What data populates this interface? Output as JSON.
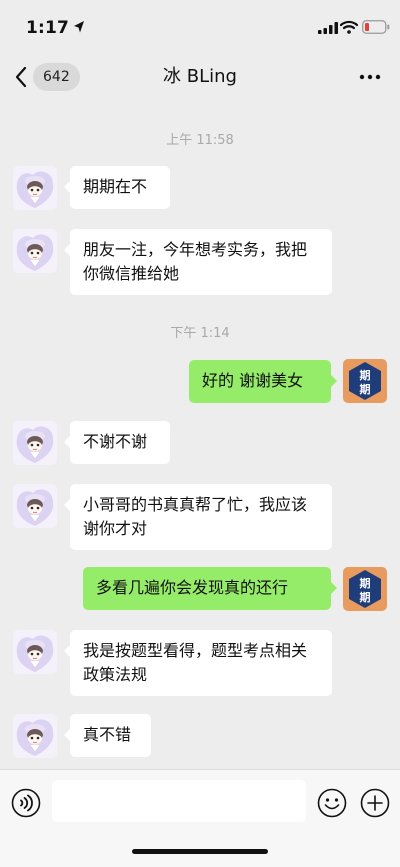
{
  "status_bar": {
    "time": "1:17",
    "icons": [
      "location-arrow-icon",
      "signal-icon",
      "wifi-icon",
      "battery-low-icon"
    ]
  },
  "nav": {
    "unread_count": "642",
    "title": "冰 BLing",
    "icons": [
      "back-icon",
      "more-icon"
    ]
  },
  "messages": {
    "t1": "上午 11:58",
    "m1": "期期在不",
    "m2": "朋友一注，今年想考实务，我把你微信推给她",
    "t2": "下午 1:14",
    "m3": "好的 谢谢美女",
    "m4": "不谢不谢",
    "m5": "小哥哥的书真真帮了忙，我应该谢你才对",
    "m6": "多看几遍你会发现真的还行",
    "m7": "我是按题型看得，题型考点相关政策法规",
    "m8": "真不错"
  },
  "self_avatar": {
    "text_top": "期",
    "text_bottom": "期"
  },
  "input_bar": {
    "icons": [
      "voice-icon",
      "emoji-icon",
      "plus-icon"
    ]
  },
  "colors": {
    "background": "#ededed",
    "outgoing_bubble": "#95ec69",
    "incoming_bubble": "#ffffff",
    "avatar_orange": "#e79b5f",
    "avatar_navy": "#1f3d7a",
    "battery_red": "#e5413b"
  }
}
